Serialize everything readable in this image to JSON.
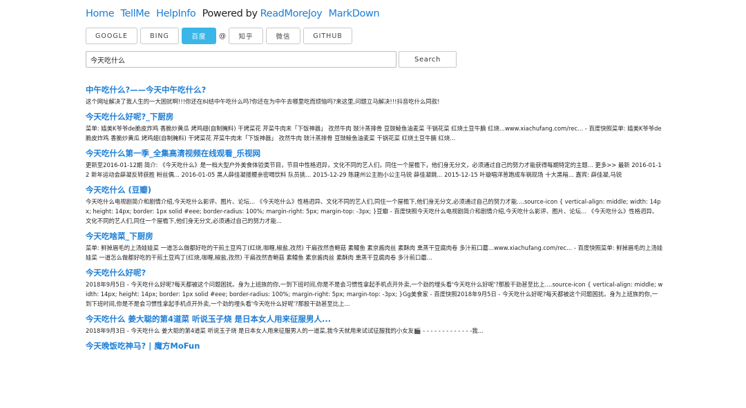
{
  "nav": {
    "home": "Home",
    "tellme": "TellMe",
    "helpinfo": "HelpInfo",
    "powered_by": "Powered by",
    "readmorejoy": "ReadMoreJoy",
    "markdown": "MarkDown"
  },
  "engines": {
    "google": "GOOGLE",
    "bing": "BING",
    "baidu": "百度",
    "at": "@",
    "zhihu": "知乎",
    "weixin": "微信",
    "github": "GITHUB",
    "active": "百度"
  },
  "search": {
    "query": "今天吃什么",
    "button": "Search"
  },
  "results": [
    {
      "title": "中午吃什么?——今天中午吃什么?",
      "snippet": "这个网址解决了我人生的一大困扰啊!!!你还在纠结中午吃什么吗?你还在为中午去哪里吃而烦恼吗?来这里,问题立马解决!!!抖音吃什么同款!"
    },
    {
      "title": "今天吃什么好呢?_下厨房",
      "snippet": "菜单: 嫱美K爷爷de脆皮炸鸡 香脆炒黄瓜 烤鸡翅(自制腌料) 干烤菜花 芹菜牛肉末「下饭神器」 孜然牛肉 豉汁蒸排骨 豆豉鲮鱼油麦菜 干锅花菜 红烧土豆牛腩 红烧...www.xiachufang.com/rec... - 百度快照菜单: 嫱美K爷爷de脆皮炸鸡 香脆炒黄瓜 烤鸡翅(自制腌料) 干烤菜花 芹菜牛肉末「下饭神器」 孜然牛肉 豉汁蒸排骨 豆豉鲮鱼油麦菜 干锅花菜 红烧土豆牛腩 红烧..."
    },
    {
      "title": "今天吃什么第一季_全集高清视频在线观看_乐视网",
      "snippet": "更新至2016-01-12期 简介: 《今天吃什么》是一档大型户外美食体验类节目，节目中性格迥异，文化不同的艺人们，同住一个屋檐下，他们身无分文，必须通过自己的努力才能获得每期特定的主题... 更多>> 最新 2016-01-12 新年运动会薛凝反转获胜 粉丝偶... 2016-01-05 黑人薛佳凝搂腰亲密喝饮料 队员挑... 2015-12-29 陈建州公主抱小公主马锐 薛佳凝跳... 2015-12-15 叶璇唱洋葱跑成车祸现场 十大黑暗... 嘉宾: 薛佳凝,马锐"
    },
    {
      "title": "今天吃什么 (豆瓣)",
      "snippet": "今天吃什么电视剧简介和剧情介绍,今天吃什么影评、图片、论坛... 《今天吃什么》性格迥异、文化不同的艺人们,同住一个屋檐下,他们身无分文,必须通过自己的努力才能....source-icon { vertical-align: middle; width: 14px; height: 14px; border: 1px solid #eee; border-radius: 100%; margin-right: 5px; margin-top: -3px; }豆瓣 - 百度快照今天吃什么电视剧简介和剧情介绍,今天吃什么影评、图片、论坛... 《今天吃什么》性格迥异、文化不同的艺人们,同住一个屋檐下,他们身无分文,必须通过自己的努力才能..."
    },
    {
      "title": "今天吃啥菜_下厨房",
      "snippet": "菜单: 鲜掉眉毛的上汤娃娃菜 一道怎么做都好吃的干煎土豆鸡丁(红烧,咖喱,椒盐,孜然) 干扁孜然杏鲍菇 素鳗鱼 素京酱肉丝 素酥肉 熏蒸干豆腐肉卷 多汁煎口蘑...www.xiachufang.com/rec... - 百度快照菜单: 鲜掉眉毛的上汤娃娃菜 一道怎么做都好吃的干煎土豆鸡丁(红烧,咖喱,椒盐,孜然) 干扁孜然杏鲍菇 素鳗鱼 素京酱肉丝 素酥肉 熏蒸干豆腐肉卷 多汁煎口蘑..."
    },
    {
      "title": "今天吃什么好呢?",
      "snippet": "2018年9月5日 - 今天吃什么好呢?每天都被这个问题困扰。身为上班族的你,一到下班时间,你是不是会习惯性拿起手机点开外卖,一个劲的埋头看'今天吃什么好呢'?那股干劲甚至比上....source-icon { vertical-align: middle; width: 14px; height: 14px; border: 1px solid #eee; border-radius: 100%; margin-right: 5px; margin-top: -3px; }Gg美食家 - 百度快照2018年9月5日 - 今天吃什么好呢?每天都被这个问题困扰。身为上班族的你,一到下班时间,你是不是会习惯性拿起手机点开外卖,一个劲的埋头看'今天吃什么好呢'?那股干劲甚至比上..."
    },
    {
      "title": "今天吃什么 姜大聪的第4道菜 听说玉子烧 是日本女人用来征服男人...",
      "snippet": "2018年9月3日 - 今天吃什么 姜大聪的第4道菜 听说玉子烧 是日本女人用来征服男人的一道菜,我今天就用来试试征服我的小女友🎬 - - - - - - - - - - - - -我..."
    },
    {
      "title": "今天晚饭吃神马? | 魔方MoFun",
      "snippet": ""
    }
  ]
}
